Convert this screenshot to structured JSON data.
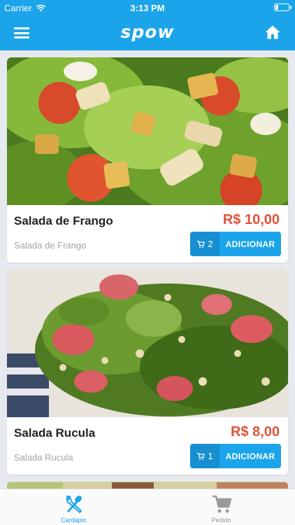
{
  "status_bar": {
    "carrier": "Carrier",
    "time": "3:13 PM",
    "battery_level": 0.25
  },
  "header": {
    "logo": "spow",
    "menu_icon": "hamburger-menu-icon",
    "home_icon": "home-icon"
  },
  "products": [
    {
      "name": "Salada de Frango",
      "price": "R$ 10,00",
      "description": "Salada de Frango",
      "cart_count": "2",
      "add_label": "ADICIONAR",
      "image": "chicken-caesar-salad-photo"
    },
    {
      "name": "Salada Rucula",
      "price": "R$ 8,00",
      "description": "Salada Rucula",
      "cart_count": "1",
      "add_label": "ADICIONAR",
      "image": "arugula-salad-photo"
    }
  ],
  "tabs": [
    {
      "label": "Cardápio",
      "icon": "fork-spoon-icon",
      "active": true
    },
    {
      "label": "Pedido",
      "icon": "cart-icon",
      "active": false
    }
  ],
  "colors": {
    "primary": "#1ba4ea",
    "primary_dark": "#178fd0",
    "price": "#e2533a",
    "background": "#e6eaee"
  }
}
